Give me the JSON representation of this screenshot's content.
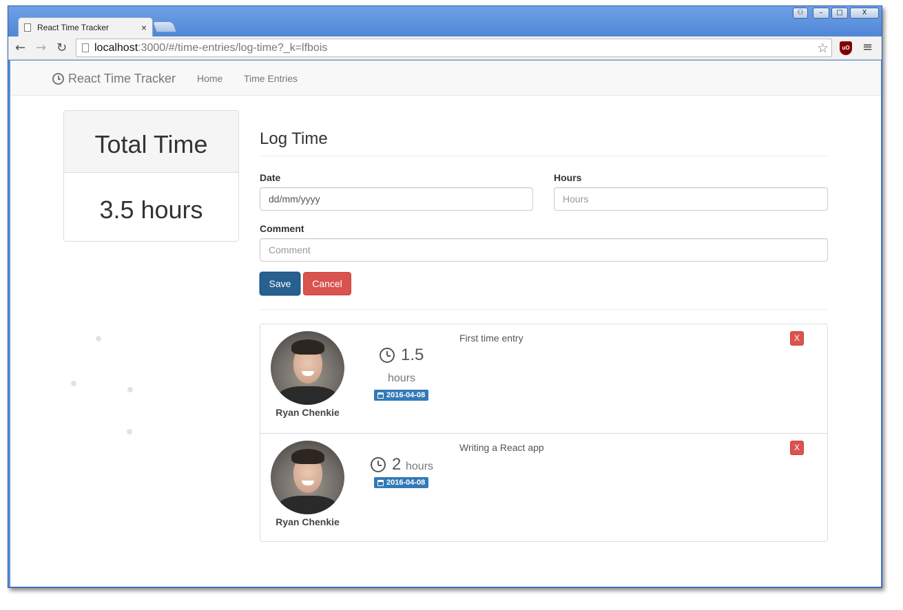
{
  "browser": {
    "tab_title": "React Time Tracker",
    "tab_close": "×",
    "url_host": "localhost",
    "url_rest": ":3000/#/time-entries/log-time?_k=lfbois",
    "back": "←",
    "forward": "→",
    "reload": "↻",
    "star": "☆",
    "menu": "≡",
    "ext_label": "uO",
    "win_min": "–",
    "win_max": "□",
    "win_close": "X",
    "win_user": "⚇"
  },
  "navbar": {
    "brand": "React Time Tracker",
    "links": [
      "Home",
      "Time Entries"
    ]
  },
  "total": {
    "heading": "Total Time",
    "value": "3.5 hours"
  },
  "form": {
    "title": "Log Time",
    "date_label": "Date",
    "date_value": "dd/mm/yyyy",
    "hours_label": "Hours",
    "hours_placeholder": "Hours",
    "comment_label": "Comment",
    "comment_placeholder": "Comment",
    "save_label": "Save",
    "cancel_label": "Cancel"
  },
  "entries": [
    {
      "user": "Ryan Chenkie",
      "hours": "1.5",
      "hours_unit": "hours",
      "date": "2016-04-08",
      "comment": "First time entry",
      "delete_label": "X"
    },
    {
      "user": "Ryan Chenkie",
      "hours": "2",
      "hours_unit": "hours",
      "date": "2016-04-08",
      "comment": "Writing a React app",
      "delete_label": "X"
    }
  ],
  "colors": {
    "primary": "#286090",
    "danger": "#d9534f",
    "badge": "#337ab7"
  }
}
